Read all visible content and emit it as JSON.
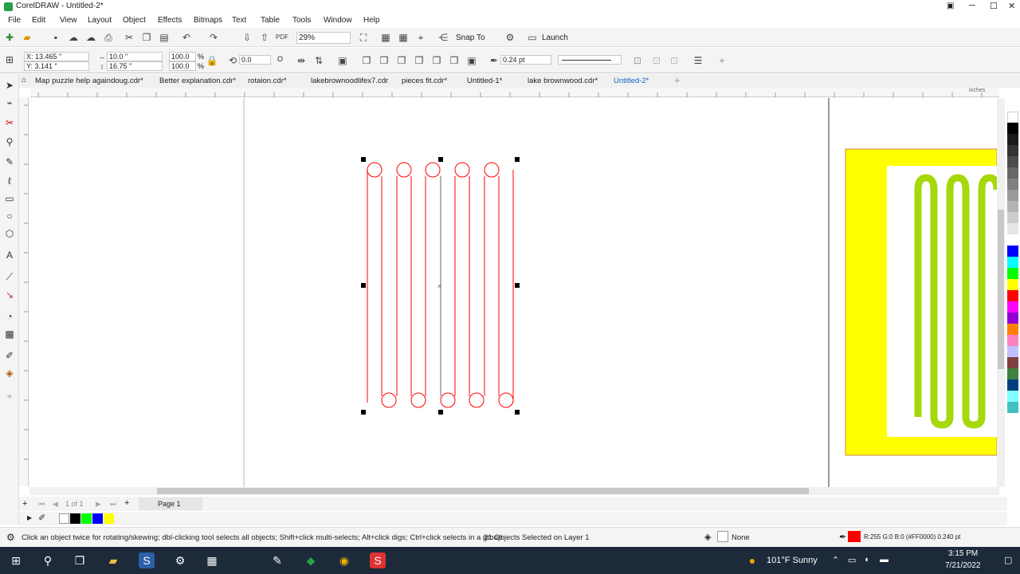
{
  "app": {
    "title": "CorelDRAW - Untitled-2*"
  },
  "window_controls": {
    "minimize": "─",
    "maximize": "☐",
    "close": "✕"
  },
  "menu": [
    "File",
    "Edit",
    "View",
    "Layout",
    "Object",
    "Effects",
    "Bitmaps",
    "Text",
    "Table",
    "Tools",
    "Window",
    "Help"
  ],
  "toolbar": {
    "zoom": "29%",
    "snap_to": "Snap To",
    "launch": "Launch"
  },
  "property_bar": {
    "x": "X: 13.465 \"",
    "y": "Y: 3.141 \"",
    "width": "10.0 \"",
    "height": "16.75 \"",
    "scale_w": "100.0",
    "scale_h": "100.0",
    "percent_w": "%",
    "percent_h": "%",
    "rotation": "0.0",
    "rotation_unit": "O",
    "outline_width": "0.24 pt"
  },
  "doc_tabs": [
    "Map puzzle help againdoug.cdr*",
    "Better explanation.cdr*",
    "rotaion.cdr*",
    "lakebrownoodlifex7.cdr",
    "pieces fit.cdr*",
    "Untitled-1*",
    "lake brownwood.cdr*",
    "Untitled-2*"
  ],
  "ruler_unit": "inches",
  "page_nav": {
    "count": "1 of 1",
    "page_tab": "Page 1"
  },
  "status": {
    "hint": "Click an object twice for rotating/skewing; dbl-clicking tool selects all objects; Shift+click multi-selects; Alt+click digs; Ctrl+click selects in a group",
    "selection": "21 Objects Selected on Layer 1",
    "fill": "None",
    "outline": "R:255 G:0 B:0 (#FF0000)  0.240 pt"
  },
  "taskbar": {
    "weather": "101°F  Sunny",
    "time": "3:15 PM",
    "date": "7/21/2022"
  },
  "colors": {
    "accent_tab": "#1565c0",
    "outline_red": "#ff0000",
    "yellow": "#ffff00",
    "green": "#a6d80a"
  },
  "palette": [
    "#ffffff",
    "#000000",
    "#1a1a1a",
    "#333333",
    "#4d4d4d",
    "#666666",
    "#808080",
    "#999999",
    "#b3b3b3",
    "#cccccc",
    "#e6e6e6",
    "#ffffff",
    "#0000ff",
    "#00ffff",
    "#00ff00",
    "#ffff00",
    "#ff0000",
    "#ff00ff",
    "#9400d3",
    "#ff8000",
    "#ff80c0",
    "#c0c0ff",
    "#804040",
    "#408040",
    "#004080",
    "#80ffff",
    "#40c0c0"
  ],
  "doc_palette": [
    "#ffffff",
    "#000000",
    "#00ff00",
    "#0000ff",
    "#ffff00"
  ]
}
